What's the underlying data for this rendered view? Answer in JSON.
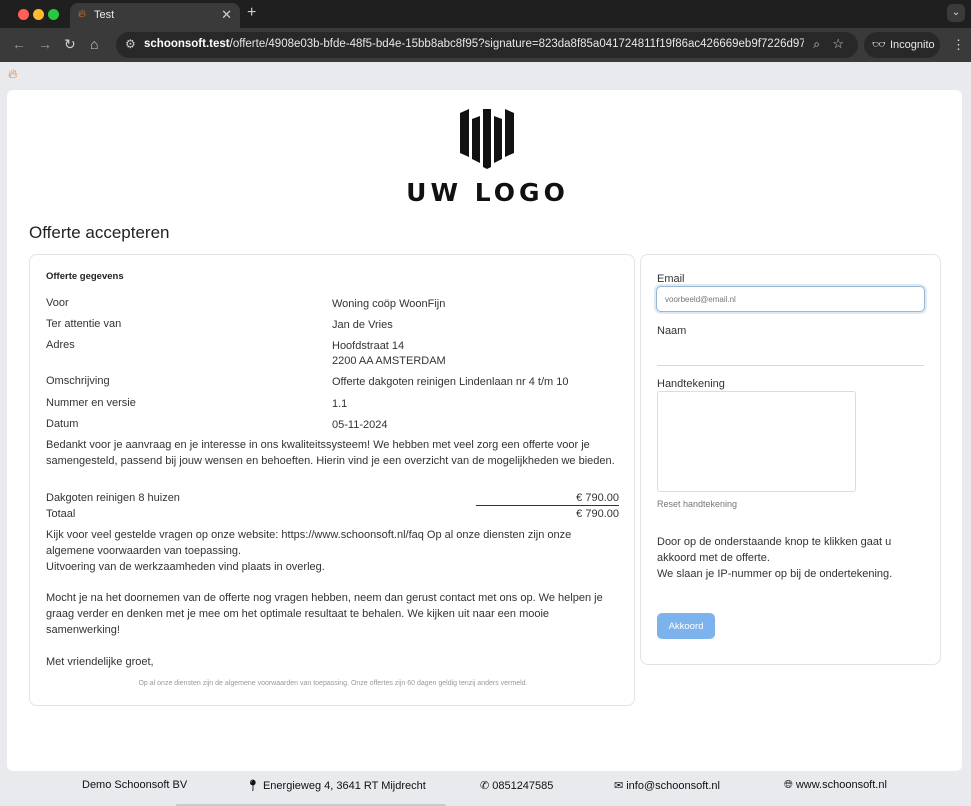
{
  "browser": {
    "tab_title": "Test",
    "tab_favicon": "flame-icon",
    "url_host": "schoonsoft.test",
    "url_rest": "/offerte/4908e03b-bfde-48f5-bd4e-15bb8abc8f95?signature=823da8f85a041724811f19f86ac426669eb9f7226d975...",
    "incognito_label": "Incognito"
  },
  "header": {
    "logo_text": "UW LOGO",
    "title": "Offerte accepteren"
  },
  "offer": {
    "section_title": "Offerte gegevens",
    "rows": [
      {
        "label": "Voor",
        "value": "Woning coöp WoonFijn"
      },
      {
        "label": "Ter attentie van",
        "value": "Jan de Vries"
      },
      {
        "label": "Adres",
        "value": "Hoofdstraat 14",
        "value2": "2200 AA AMSTERDAM"
      },
      {
        "label": "Omschrijving",
        "value": "Offerte dakgoten reinigen Lindenlaan nr 4 t/m 10"
      },
      {
        "label": "Nummer en versie",
        "value": "1.1"
      },
      {
        "label": "Datum",
        "value": "05-11-2024"
      }
    ],
    "intro": "Bedankt voor je aanvraag en je interesse in ons kwaliteitssysteem! We hebben met veel zorg een offerte voor je samengesteld, passend bij jouw wensen en behoeften. Hierin vind je een overzicht van de mogelijkheden we bieden.",
    "lines": [
      {
        "label": "Dakgoten reinigen 8 huizen",
        "amount": "€ 790.00"
      }
    ],
    "total_label": "Totaal",
    "total_amount": "€ 790.00",
    "faq": "Kijk voor veel gestelde vragen op onze website: https://www.schoonsoft.nl/faq Op al onze diensten zijn onze algemene voorwaarden van toepassing.",
    "execution": "Uitvoering van de werkzaamheden vind plaats in overleg.",
    "questions": "Mocht je na het doornemen van de offerte nog vragen hebben, neem dan gerust contact met ons op. We helpen je graag verder en denken met je mee om het optimale resultaat te behalen. We kijken uit naar een mooie samenwerking!",
    "greeting": "Met vriendelijke groet,",
    "footnote": "Op al onze diensten zijn de algemene voorwaarden van toepassing. Onze offertes zijn 60 dagen geldig tenzij anders vermeld."
  },
  "form": {
    "email_label": "Email",
    "email_placeholder": "voorbeeld@email.nl",
    "name_label": "Naam",
    "signature_label": "Handtekening",
    "reset_label": "Reset handtekening",
    "consent_line1": "Door op de onderstaande knop te klikken gaat u akkoord met de offerte.",
    "consent_line2": "We slaan je IP-nummer op bij de ondertekening.",
    "accept_label": "Akkoord",
    "accept_color": "#7db3ec"
  },
  "footer": {
    "company": "Demo Schoonsoft BV",
    "address": "Energieweg 4, 3641 RT Mijdrecht",
    "phone": "0851247585",
    "email": "info@schoonsoft.nl",
    "website": "www.schoonsoft.nl"
  }
}
